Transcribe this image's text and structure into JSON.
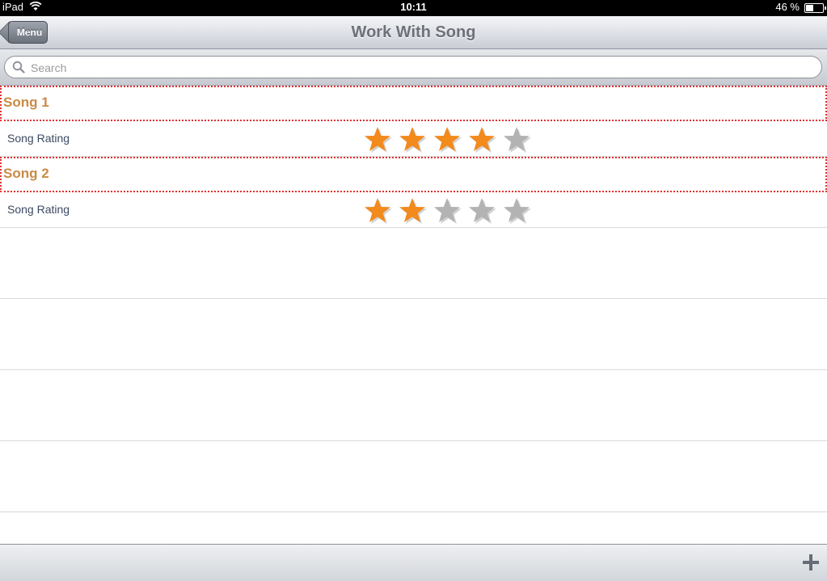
{
  "status_bar": {
    "carrier": "iPad",
    "time": "10:11",
    "battery_percent": "46 %",
    "battery_level": 0.46
  },
  "nav_bar": {
    "back_label": "Menu",
    "title": "Work With Song"
  },
  "search": {
    "placeholder": "Search",
    "value": ""
  },
  "songs": [
    {
      "name": "Song 1",
      "rating_label": "Song Rating",
      "rating": 4,
      "max_rating": 5
    },
    {
      "name": "Song 2",
      "rating_label": "Song Rating",
      "rating": 2,
      "max_rating": 5
    }
  ],
  "toolbar": {
    "add_label": "+"
  },
  "colors": {
    "star_on": "#f28a1c",
    "star_off": "#b3b3b3",
    "section_title": "#c98a45",
    "section_border": "#e03030"
  }
}
